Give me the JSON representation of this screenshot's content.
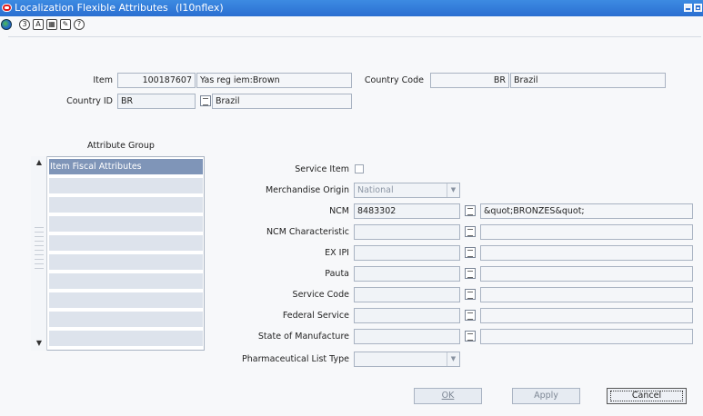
{
  "window": {
    "title": "Localization Flexible Attributes",
    "code": "(l10nflex)"
  },
  "toolbar": {
    "icons": [
      "globe-icon",
      "help-icon",
      "spell-icon",
      "calendar-icon",
      "note-icon",
      "question-icon"
    ]
  },
  "header": {
    "item_label": "Item",
    "item_value": "100187607",
    "item_desc": "Yas reg iem:Brown",
    "country_code_label": "Country Code",
    "country_code_value": "BR",
    "country_code_desc": "Brazil",
    "country_id_label": "Country ID",
    "country_id_value": "BR",
    "country_id_desc": "Brazil"
  },
  "attribute_group": {
    "title": "Attribute Group",
    "items": [
      "Item Fiscal Attributes",
      "",
      "",
      "",
      "",
      "",
      "",
      "",
      "",
      ""
    ]
  },
  "attributes": {
    "service_item_label": "Service Item",
    "merch_origin_label": "Merchandise Origin",
    "merch_origin_value": "National",
    "ncm_label": "NCM",
    "ncm_value": "8483302",
    "ncm_desc": "&quot;BRONZES&quot;",
    "ncm_char_label": "NCM Characteristic",
    "ex_ipi_label": "EX IPI",
    "pauta_label": "Pauta",
    "service_code_label": "Service Code",
    "federal_service_label": "Federal Service",
    "state_manufacture_label": "State of Manufacture",
    "pharma_list_label": "Pharmaceutical List Type"
  },
  "buttons": {
    "ok": "OK",
    "apply": "Apply",
    "cancel": "Cancel"
  }
}
